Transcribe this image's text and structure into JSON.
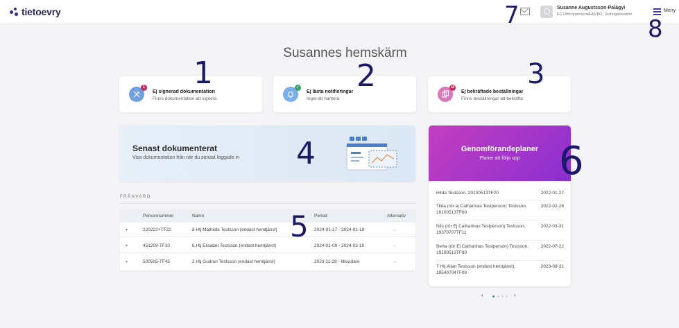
{
  "header": {
    "logo_text": "tietoevry",
    "user_name": "Susanne Augustsson-Palágyi",
    "user_role": "EC.UtförarpersonalHtjVBG, Testorganisation",
    "menu_label": "Meny",
    "icons": [
      "logo-mark",
      "mail-icon",
      "avatar",
      "menu-icon"
    ]
  },
  "page_title": "Susannes hemskärm",
  "tiles": [
    {
      "title": "Ej signerad dokumentation",
      "subtitle": "Finns dokumentation att signera",
      "badge": "1",
      "icon": "pen-icon",
      "color": "#6fa0e0",
      "badge_color": "#d0245a"
    },
    {
      "title": "Ej lästa notifieringar",
      "subtitle": "Inget att hantera",
      "badge": "✓",
      "icon": "bell-icon",
      "color": "#7ab0e8",
      "badge_color": "#3aa66a"
    },
    {
      "title": "Ej bekräftade beställningar",
      "subtitle": "Finns beställningar att bekräfta",
      "badge": "10",
      "icon": "orders-icon",
      "color": "#d878b8",
      "badge_color": "#d0245a"
    }
  ],
  "banner": {
    "title": "Senast dokumenterat",
    "subtitle": "Visa dokumentation från när du senast loggade in"
  },
  "plans": {
    "title": "Genomförandeplaner",
    "subtitle": "Planer att följa upp",
    "rows": [
      {
        "name": "Hilda Testsson, 20100513TF20",
        "date": "2022-01-27"
      },
      {
        "name": "Tilda (rör ej Catharinas Testperson) Testsson, 19100513TF60",
        "date": "2022-02-28"
      },
      {
        "name": "Nils (rör Ej Catharinas Testperson) Testsson, 19370707TF11",
        "date": "2022-03-31"
      },
      {
        "name": "Berta (rör Ej Catharinas Testperson) Testsson, 19100513TF80",
        "date": "2022-07-22"
      },
      {
        "name": "7 Htj Allan Testsson (endast hemtjänst), 19540704TF09",
        "date": "2023-08-31"
      }
    ],
    "pager": {
      "prev": "‹",
      "next": "›"
    }
  },
  "absence": {
    "label": "FRÅNVARO",
    "columns": [
      "Personnummer",
      "Namn",
      "Period",
      "Alternativ"
    ],
    "rows": [
      {
        "pnr": "220222+TF22",
        "name": "8 Htj Mathilda Testsson (endast hemtjänst)",
        "period": "2024-01-17 - 2024-01-19",
        "action": "→"
      },
      {
        "pnr": "451209-TF10",
        "name": "6 Htj Elisabet Testsson (endast hemtjänst)",
        "period": "2024-01-09 - 2024-03-10",
        "action": "→"
      },
      {
        "pnr": "500505-TF45",
        "name": "2 Htj Gudrun Testsson (endast hemtjänst)",
        "period": "2023-11-28 - tillsvidare",
        "action": "→"
      }
    ]
  },
  "annotations": [
    "1",
    "2",
    "3",
    "4",
    "5",
    "6",
    "7",
    "8"
  ]
}
